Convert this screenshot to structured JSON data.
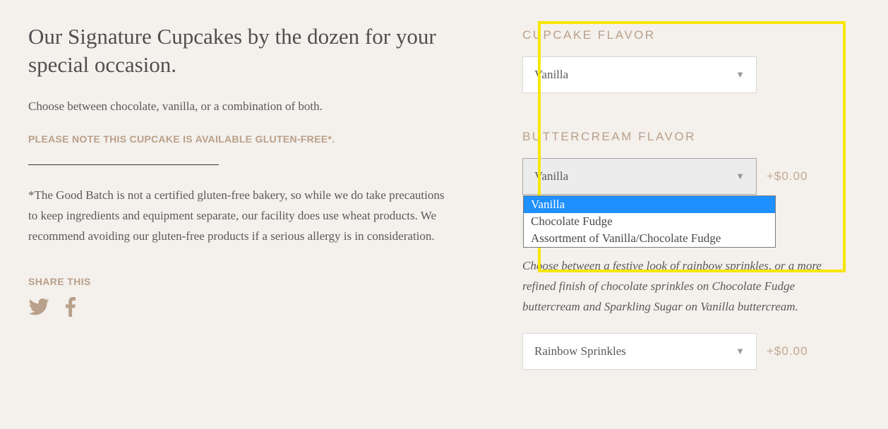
{
  "left": {
    "heading": "Our Signature Cupcakes by the dozen for your special occasion.",
    "subtitle": "Choose between chocolate, vanilla, or a combination of both.",
    "notice": "PLEASE NOTE THIS CUPCAKE IS AVAILABLE GLUTEN-FREE*.",
    "disclaimer": "*The Good Batch is not a certified gluten-free bakery, so while we do take precautions to keep ingredients and equipment separate, our facility does use wheat products. We recommend avoiding our gluten-free products if a serious allergy is in consideration.",
    "share_label": "SHARE THIS"
  },
  "options": {
    "cupcake_flavor": {
      "label": "CUPCAKE FLAVOR",
      "selected": "Vanilla"
    },
    "buttercream_flavor": {
      "label": "BUTTERCREAM FLAVOR",
      "selected": "Vanilla",
      "price": "+$0.00",
      "items": [
        "Vanilla",
        "Chocolate Fudge",
        "Assortment of Vanilla/Chocolate Fudge"
      ]
    },
    "finishing_touch": {
      "description": "Choose between a festive look of  rainbow sprinkles, or a more refined finish of chocolate sprinkles on Chocolate Fudge buttercream and Sparkling Sugar on Vanilla buttercream.",
      "selected": "Rainbow Sprinkles",
      "price": "+$0.00"
    }
  }
}
